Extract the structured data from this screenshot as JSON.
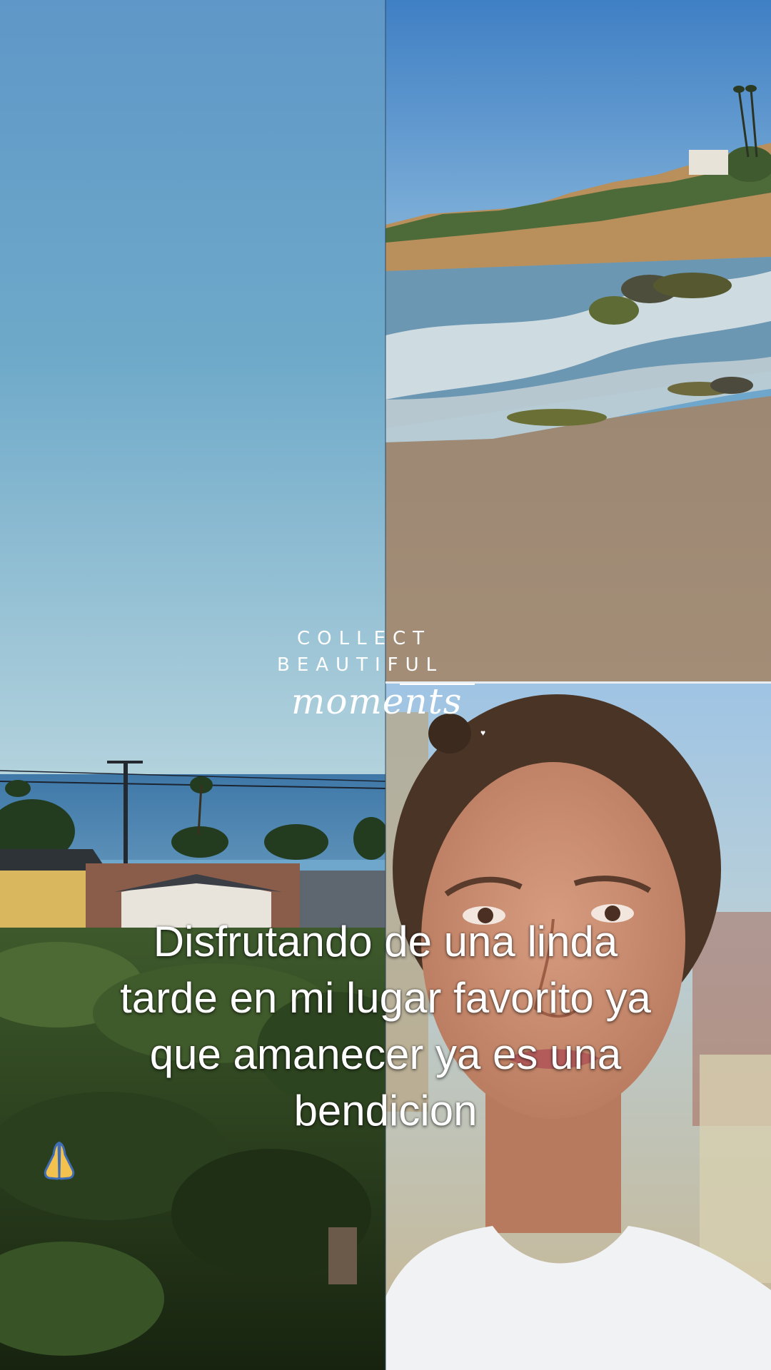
{
  "overlay": {
    "brand_line1": "COLLECT",
    "brand_line2": "BEAUTIFUL",
    "brand_script": "moments"
  },
  "caption": {
    "line1": "Disfrutando de una linda",
    "line2": "tarde en mi lugar favorito ya",
    "line3": "que amanecer ya es una",
    "line4": "bendicion"
  },
  "icons": {
    "caption_emoji": "folded-hands-icon"
  },
  "photos": {
    "left": "coastal-neighborhood-ocean-view",
    "right_top": "beach-shoreline-rocks",
    "right_bottom": "woman-selfie"
  },
  "colors": {
    "sky_top": "#5f97c8",
    "sky_bottom": "#b7d4e0",
    "sand": "#a68f78",
    "caption_text": "#ffffff"
  }
}
